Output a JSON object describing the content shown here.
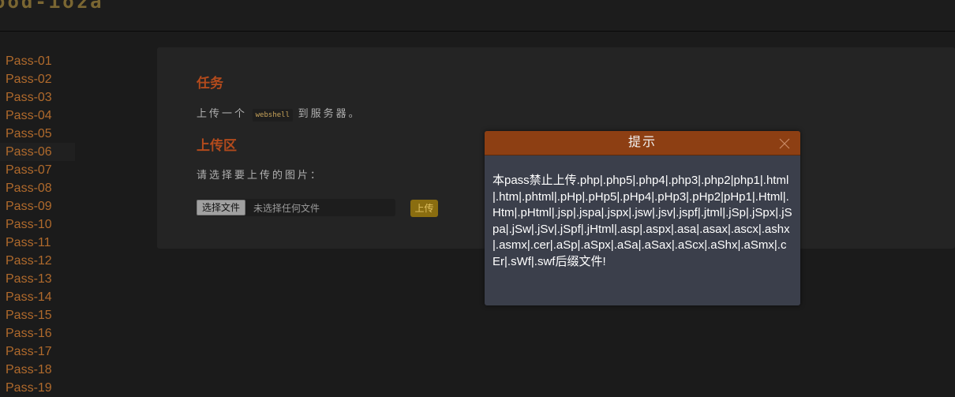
{
  "header": {
    "logo": "ood-ioza"
  },
  "sidebar": {
    "active": "Pass-06",
    "items": [
      "Pass-01",
      "Pass-02",
      "Pass-03",
      "Pass-04",
      "Pass-05",
      "Pass-06",
      "Pass-07",
      "Pass-08",
      "Pass-09",
      "Pass-10",
      "Pass-11",
      "Pass-12",
      "Pass-13",
      "Pass-14",
      "Pass-15",
      "Pass-16",
      "Pass-17",
      "Pass-18",
      "Pass-19"
    ]
  },
  "task": {
    "heading": "任务",
    "text_before": "上传一个",
    "code": "webshell",
    "text_after": "到服务器。"
  },
  "upload": {
    "heading": "上传区",
    "prompt": "请选择要上传的图片：",
    "choose_file": "选择文件",
    "no_file": "未选择任何文件",
    "submit": "上传"
  },
  "modal": {
    "title": "提示",
    "message": "本pass禁止上传.php|.php5|.php4|.php3|.php2|php1|.html|.htm|.phtml|.pHp|.pHp5|.pHp4|.pHp3|.pHp2|pHp1|.Html|.Htm|.pHtml|.jsp|.jspa|.jspx|.jsw|.jsv|.jspf|.jtml|.jSp|.jSpx|.jSpa|.jSw|.jSv|.jSpf|.jHtml|.asp|.aspx|.asa|.asax|.ascx|.ashx|.asmx|.cer|.aSp|.aSpx|.aSa|.aSax|.aScx|.aShx|.aSmx|.cEr|.sWf|.swf后缀文件!"
  },
  "colors": {
    "accent": "#b06a2c",
    "heading": "#b24a1c",
    "modal_header": "#8d3f13",
    "modal_body": "#3b3f4b",
    "button": "#8a6d10"
  }
}
